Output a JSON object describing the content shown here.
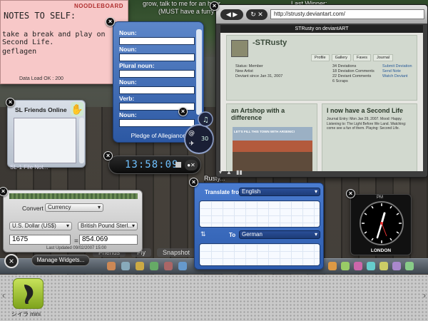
{
  "scene": {
    "chat_line1": "grow, talk to me for an hour...",
    "chat_line2": "(MUST have a furry out...",
    "last_winner": "Last Winner:",
    "rusty_name": "Rusty...",
    "nav_items": [
      "Friends",
      "Fly",
      "Snapshot"
    ]
  },
  "sticky": {
    "brand": "NOODLEBOARD",
    "title": "NOTES TO SELF:",
    "line1": "take a break and play on Second Life.",
    "line2": "geflagen",
    "status": "Data Load OK : 200"
  },
  "word_widget": {
    "labels": [
      "Noun:",
      "Noun:",
      "Plural noun:",
      "Noun:",
      "Verb:",
      "Noun:"
    ],
    "footer": "Pledge of Allegiance"
  },
  "friends": {
    "title": "SL Friends Online",
    "bottom_text": "SL-1 File Not..."
  },
  "digital_clock": {
    "time": "13:58:09"
  },
  "round_ctrl": {
    "value": "30"
  },
  "browser": {
    "url": "http://strusty.deviantart.com/",
    "page_title": "STRusty on deviantART",
    "username": "-STRusty",
    "status_lines": [
      "Status: Member",
      "New Artist",
      "Deviant since Jan 31, 2007"
    ],
    "tabs": [
      "Profile",
      "Gallery",
      "Faves",
      "Journal"
    ],
    "stats": [
      "34 Deviations",
      "18 Deviation Comments",
      "22 Deviant Comments",
      "6 Scraps"
    ],
    "links": [
      "Submit Deviation",
      "Send Note",
      "Watch Deviant"
    ],
    "post1_title": "an Artshop with a difference",
    "post1_img_text": "LET'S FILL THIS TOWN WITH ARSENIC!",
    "post2_title": "I now have a Second Life",
    "post2_body": "Journal Entry: Mon Jan 29, 2007. Mood: Happy. Listening to: The Light Before We Land. Watching: come see a fun of them. Playing: Second Life."
  },
  "currency": {
    "convert_label": "Convert",
    "category": "Currency",
    "from_currency": "U.S. Dollar (US$)",
    "to_currency": "British Pound Sterl...",
    "from_value": "1675",
    "equals": "=",
    "to_value": "854.069",
    "updated": "Last Updated 09/02/2007 15:00"
  },
  "translate": {
    "from_label": "Translate from",
    "from_lang": "English",
    "to_label": "To",
    "to_lang": "German",
    "swap_glyph": "⇅"
  },
  "analog_clock": {
    "ampm": "PM",
    "city": "LONDON"
  },
  "manage_widgets": {
    "label": "Manage Widgets..."
  },
  "dock": {
    "app_label": "シイラ mini"
  }
}
